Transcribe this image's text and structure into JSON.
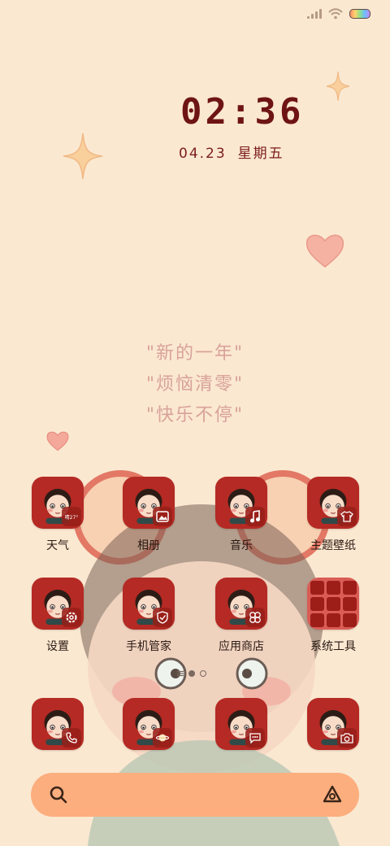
{
  "status_bar": {
    "signal_icon": "signal-icon",
    "wifi_icon": "wifi-icon",
    "battery_icon": "battery-icon"
  },
  "clock_widget": {
    "time": "02:36",
    "date": "04.23",
    "weekday": "星期五"
  },
  "quote": {
    "line1": "\"新的一年\"",
    "line2": "\"烦恼清零\"",
    "line3": "\"快乐不停\""
  },
  "apps": [
    {
      "label": "天气",
      "badge_icon": "weather-icon"
    },
    {
      "label": "相册",
      "badge_icon": "gallery-icon"
    },
    {
      "label": "音乐",
      "badge_icon": "music-icon"
    },
    {
      "label": "主题壁纸",
      "badge_icon": "tshirt-icon"
    },
    {
      "label": "设置",
      "badge_icon": "gear-icon"
    },
    {
      "label": "手机管家",
      "badge_icon": "shield-icon"
    },
    {
      "label": "应用商店",
      "badge_icon": "clover-icon"
    },
    {
      "label": "系统工具",
      "badge_icon": "folder-icon"
    }
  ],
  "weather_badge_text": "晴27°",
  "dock": [
    {
      "name": "phone",
      "badge_icon": "phone-icon"
    },
    {
      "name": "browser",
      "badge_icon": "planet-icon"
    },
    {
      "name": "messages",
      "badge_icon": "chat-icon"
    },
    {
      "name": "camera",
      "badge_icon": "camera-icon"
    }
  ],
  "page_indicator": {
    "pages": 2,
    "current": 1
  },
  "search_bar": {
    "search_icon": "search-icon",
    "assistant_icon": "assistant-icon"
  },
  "colors": {
    "background": "#fbe8d1",
    "clock_text": "#6e1414",
    "icon_red": "#b52a24",
    "search_bar": "#fcae7e",
    "quote_text": "#d8a29a"
  }
}
